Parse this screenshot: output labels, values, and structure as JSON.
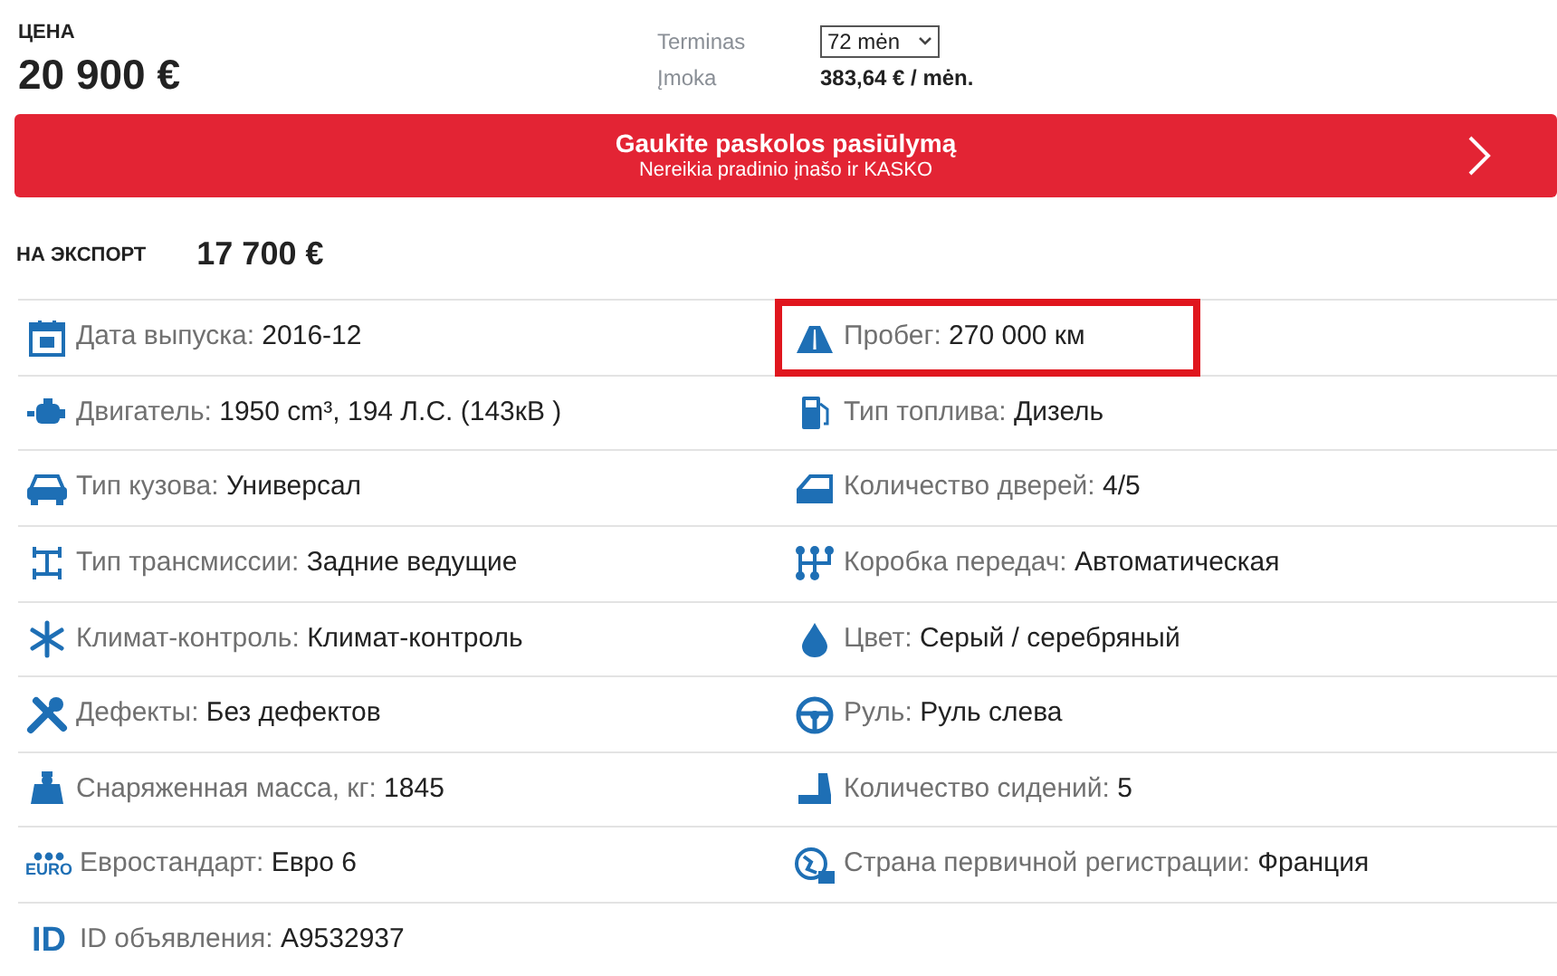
{
  "price": {
    "label": "ЦЕНА",
    "value": "20 900 €"
  },
  "loan": {
    "term_label": "Terminas",
    "term_select": "72 mėn",
    "payment_label": "Įmoka",
    "payment_value": "383,64 € / mėn."
  },
  "banner": {
    "title": "Gaukite paskolos pasiūlymą",
    "subtitle": "Nereikia pradinio įnašo ir KASKO"
  },
  "export": {
    "label": "НА ЭКСПОРТ",
    "value": "17 700 €"
  },
  "specs": [
    {
      "kind": "calendar",
      "label": "Дата выпуска:",
      "value": "2016-12",
      "highlighted": false
    },
    {
      "kind": "road",
      "label": "Пробег:",
      "value": "270 000 км",
      "highlighted": true
    },
    {
      "kind": "engine",
      "label": "Двигатель:",
      "value": "1950 cm³, 194 Л.С. (143кВ )",
      "highlighted": false
    },
    {
      "kind": "fuel",
      "label": "Тип топлива:",
      "value": "Дизель",
      "highlighted": false
    },
    {
      "kind": "car",
      "label": "Тип кузова:",
      "value": "Универсал",
      "highlighted": false
    },
    {
      "kind": "door",
      "label": "Количество дверей:",
      "value": "4/5",
      "highlighted": false
    },
    {
      "kind": "axle",
      "label": "Тип трансмиссии:",
      "value": "Задние ведущие",
      "highlighted": false
    },
    {
      "kind": "gearbox",
      "label": "Коробка передач:",
      "value": "Автоматическая",
      "highlighted": false
    },
    {
      "kind": "snowflake",
      "label": "Климат-контроль:",
      "value": "Климат-контроль",
      "highlighted": false
    },
    {
      "kind": "drop",
      "label": "Цвет:",
      "value": "Серый / серебряный",
      "highlighted": false
    },
    {
      "kind": "tools",
      "label": "Дефекты:",
      "value": "Без дефектов",
      "highlighted": false
    },
    {
      "kind": "wheel",
      "label": "Руль:",
      "value": "Руль слева",
      "highlighted": false
    },
    {
      "kind": "weight",
      "label": "Снаряженная масса, кг:",
      "value": "1845",
      "highlighted": false
    },
    {
      "kind": "seat",
      "label": "Количество сидений:",
      "value": "5",
      "highlighted": false
    },
    {
      "kind": "euro",
      "icon_text": "EURO",
      "label": "Евростандарт:",
      "value": "Евро 6",
      "highlighted": false
    },
    {
      "kind": "globe",
      "label": "Страна первичной регистрации:",
      "value": "Франция",
      "highlighted": false
    },
    {
      "kind": "id",
      "icon_text": "ID",
      "label": "ID объявления:",
      "value": "A9532937",
      "highlighted": false
    }
  ]
}
